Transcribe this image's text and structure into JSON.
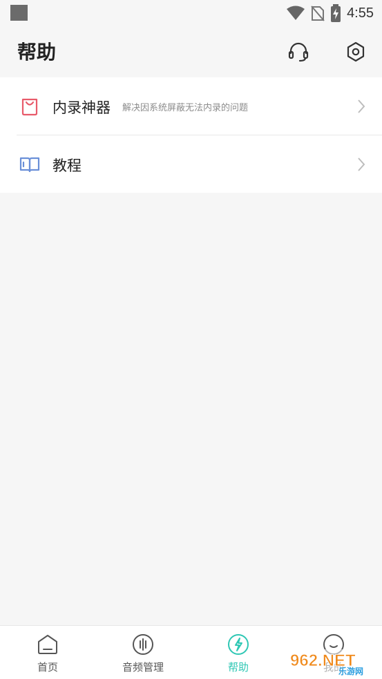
{
  "status_bar": {
    "time": "4:55"
  },
  "header": {
    "title": "帮助",
    "support_icon": "headset-icon",
    "settings_icon": "hexagon-settings-icon"
  },
  "menu": [
    {
      "title": "内录神器",
      "description": "解决因系统屏蔽无法内录的问题",
      "icon": "shopping-bag-icon",
      "icon_color": "#e85a6a"
    },
    {
      "title": "教程",
      "description": "",
      "icon": "book-icon",
      "icon_color": "#6a8fd8"
    }
  ],
  "bottom_nav": {
    "items": [
      {
        "label": "首页",
        "icon": "home-icon",
        "active": false
      },
      {
        "label": "音频管理",
        "icon": "audio-icon",
        "active": false
      },
      {
        "label": "帮助",
        "icon": "help-icon",
        "active": true
      },
      {
        "label": "我的",
        "icon": "profile-icon",
        "active": false
      }
    ],
    "active_color": "#2ec7b4"
  },
  "watermark": {
    "text": "962.NET",
    "subtext": "乐游网"
  }
}
